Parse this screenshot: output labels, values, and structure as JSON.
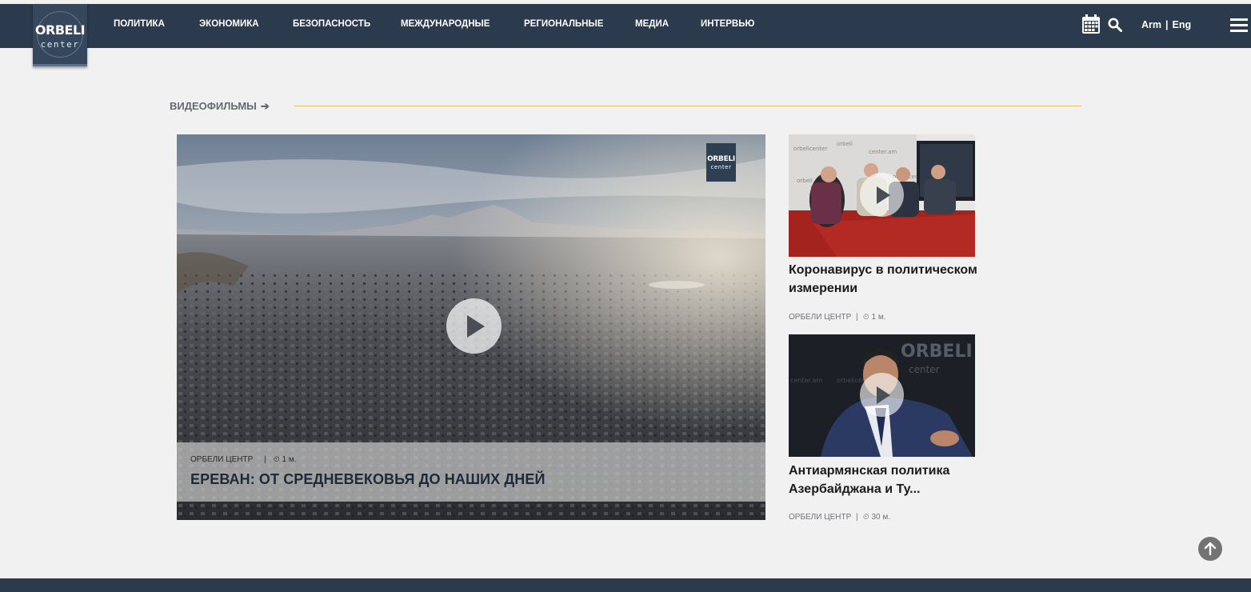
{
  "logo": {
    "main": "ORBELI",
    "sub": "center"
  },
  "nav": {
    "items": [
      "ПОЛИТИКА",
      "ЭКОНОМИКА",
      "БЕЗОПАСНОСТЬ",
      "МЕЖДУНАРОДНЫЕ",
      "РЕГИОНАЛЬНЫЕ",
      "МЕДИА",
      "ИНТЕРВЬЮ"
    ]
  },
  "header": {
    "icons": [
      "calendar-icon",
      "search-icon",
      "menu-icon"
    ],
    "lang": {
      "arm": "Arm",
      "separator": "|",
      "eng": "Eng"
    }
  },
  "section": {
    "title": "ВИДЕОФИЛЬМЫ",
    "arrow": "➔"
  },
  "featured": {
    "badge_main": "ORBELI",
    "badge_sub": "center",
    "author": "ОРБЕЛИ ЦЕНТР",
    "separator": "|",
    "time": "1 м.",
    "title": "ЕРЕВАН: ОТ СРЕДНЕВЕКОВЬЯ ДО НАШИХ ДНЕЙ"
  },
  "cards": [
    {
      "title": "Коронавирус в политическом измерении",
      "author": "ОРБЕЛИ ЦЕНТР",
      "separator": "|",
      "time": "1 м."
    },
    {
      "title": "Антиармянская политика Азербайджана и Ту...",
      "author": "ОРБЕЛИ ЦЕНТР",
      "separator": "|",
      "time": "30 м."
    }
  ],
  "colors": {
    "header_bg": "#2b3a4d",
    "page_bg": "#f1f1f1",
    "accent_line": "#f0c070",
    "headline": "#1f2a38"
  }
}
